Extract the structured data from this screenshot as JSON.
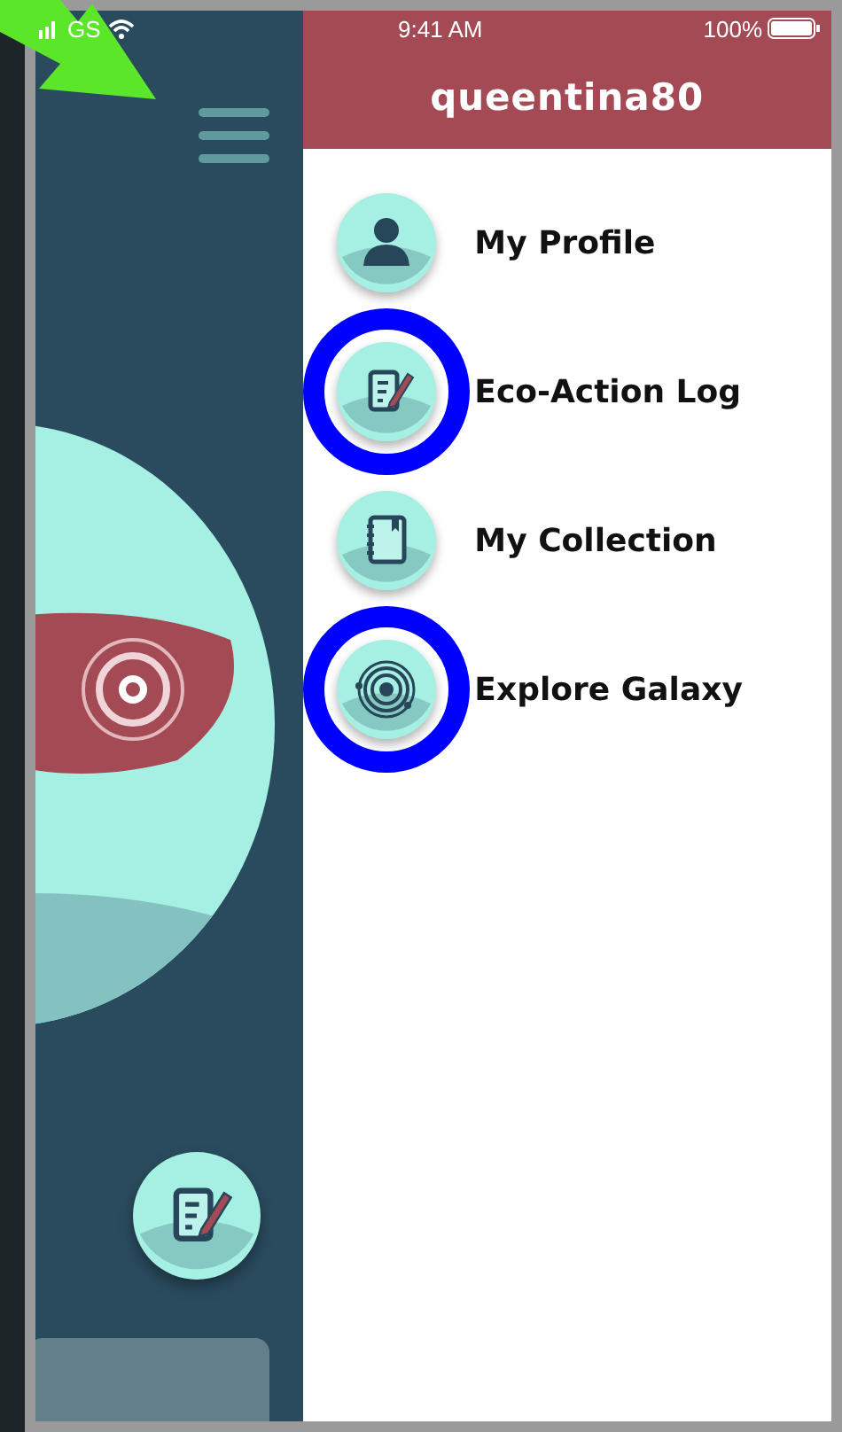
{
  "status_bar": {
    "carrier": "GS",
    "time": "9:41 AM",
    "battery": "100%"
  },
  "drawer": {
    "username": "queentina80",
    "items": [
      {
        "label": "My Profile",
        "kind": "profile",
        "highlighted": false
      },
      {
        "label": "Eco-Action Log",
        "kind": "log",
        "highlighted": true
      },
      {
        "label": "My Collection",
        "kind": "collection",
        "highlighted": false
      },
      {
        "label": "Explore Galaxy",
        "kind": "galaxy",
        "highlighted": true
      }
    ]
  }
}
